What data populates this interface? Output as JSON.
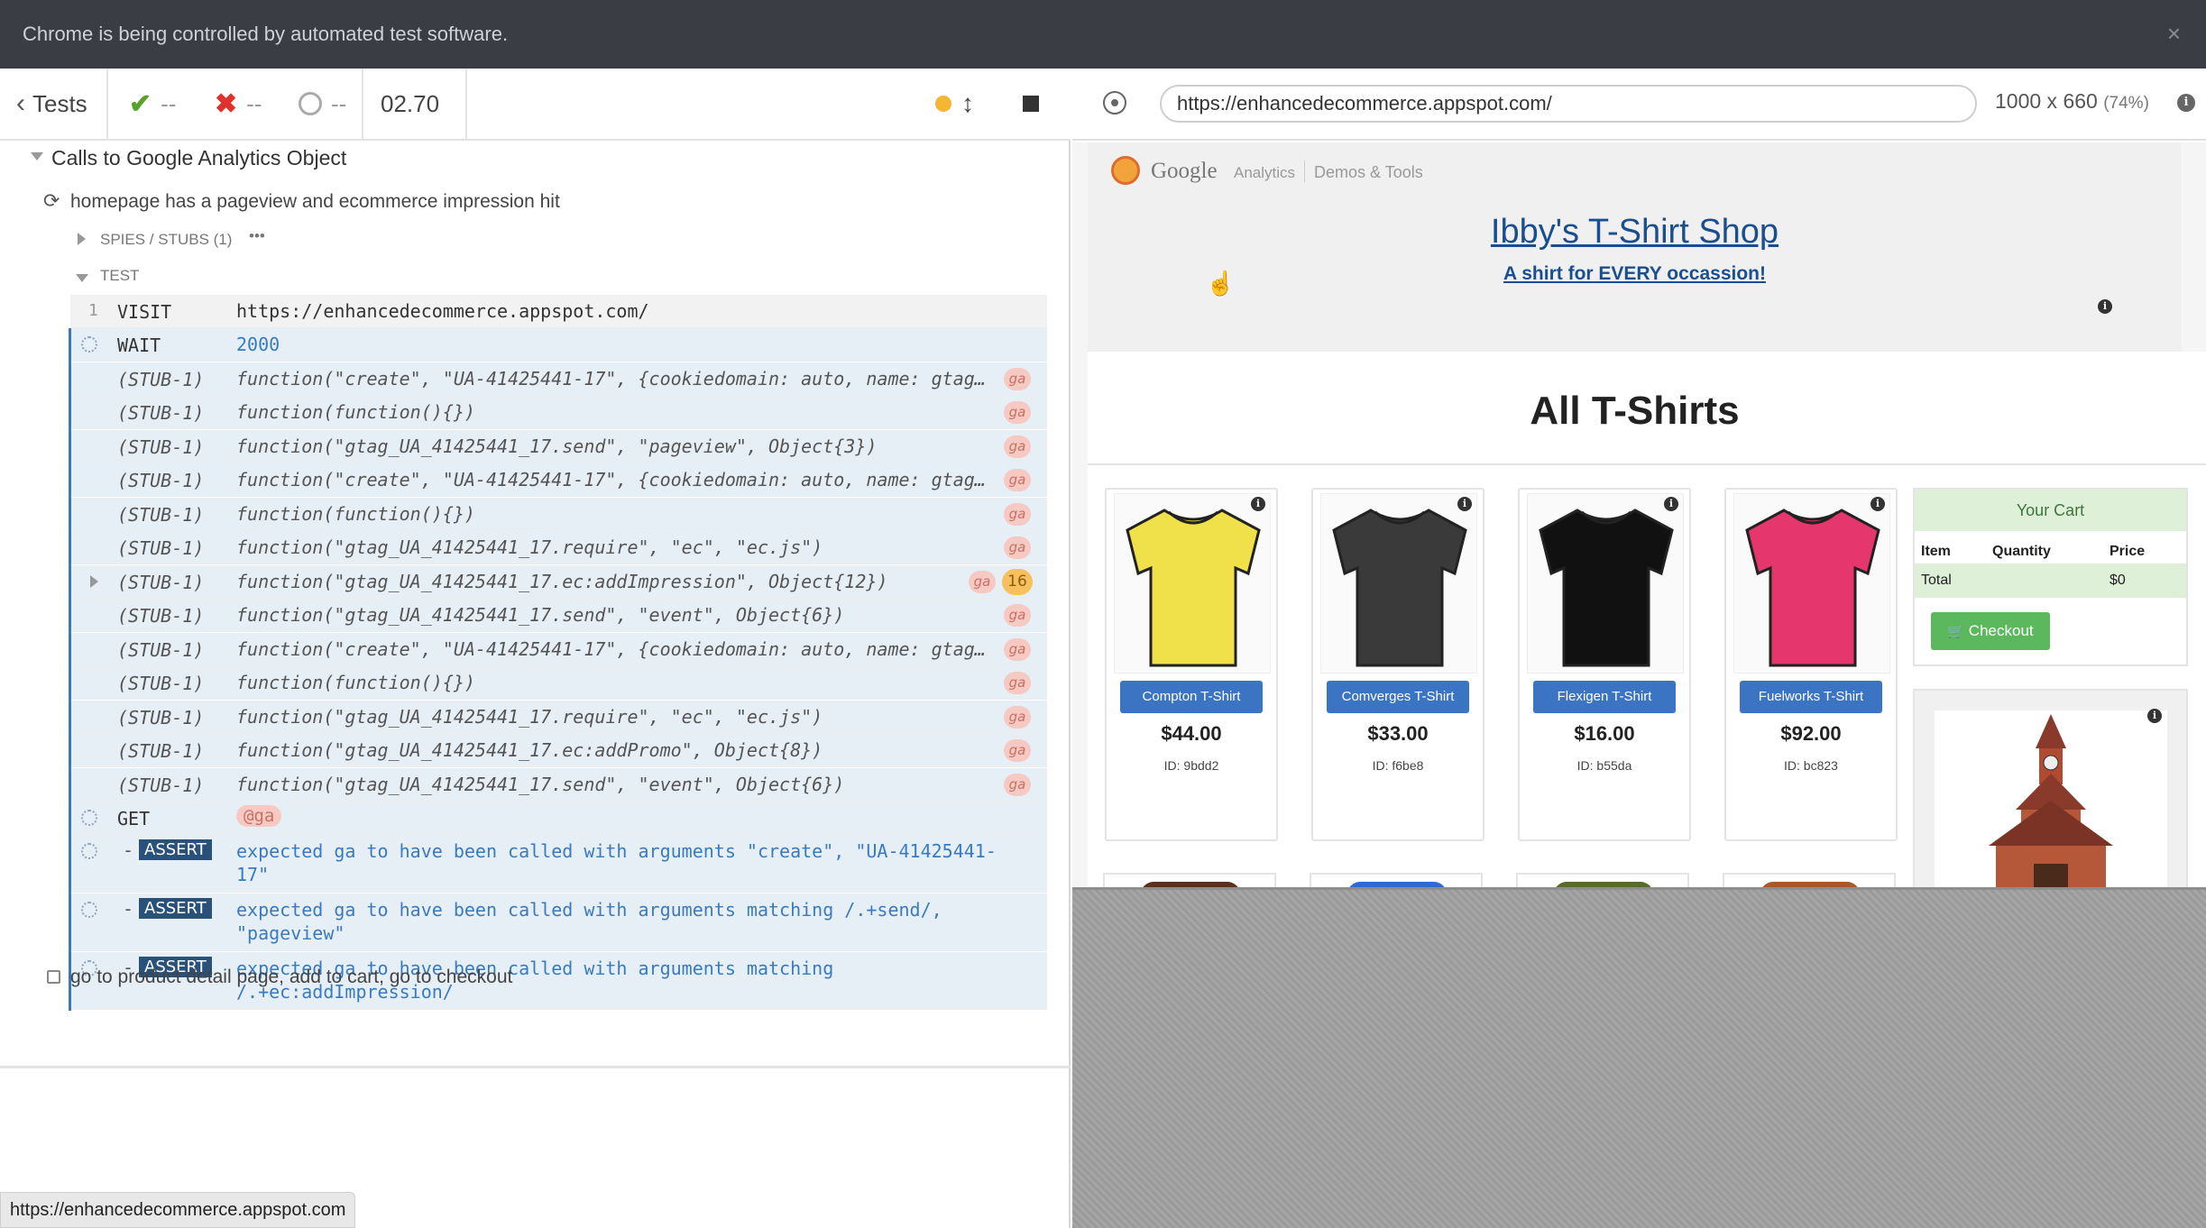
{
  "infobar": {
    "message": "Chrome is being controlled by automated test software.",
    "close": "×"
  },
  "reporter": {
    "tests_label": "Tests",
    "passed": "--",
    "failed": "--",
    "pending": "--",
    "duration": "02.70",
    "suite_title": "Calls to Google Analytics Object",
    "test_title": "homepage has a pageview and ecommerce impression hit",
    "spies_label": "SPIES / STUBS (1)",
    "spies_more": "•••",
    "test_label": "TEST",
    "commands": [
      {
        "num": "1",
        "name": "VISIT",
        "msg": "https://enhancedecommerce.appspot.com/"
      },
      {
        "num": "",
        "name": "WAIT",
        "msg": "2000"
      },
      {
        "name": "(STUB-1)",
        "msg": "function(\"create\", \"UA-41425441-17\", {cookiedomain: auto, name: gtag…",
        "badge": "ga"
      },
      {
        "name": "(STUB-1)",
        "msg": "function(function(){})",
        "badge": "ga"
      },
      {
        "name": "(STUB-1)",
        "msg": "function(\"gtag_UA_41425441_17.send\", \"pageview\", Object{3})",
        "badge": "ga"
      },
      {
        "name": "(STUB-1)",
        "msg": "function(\"create\", \"UA-41425441-17\", {cookiedomain: auto, name: gtag…",
        "badge": "ga"
      },
      {
        "name": "(STUB-1)",
        "msg": "function(function(){})",
        "badge": "ga"
      },
      {
        "name": "(STUB-1)",
        "msg": "function(\"gtag_UA_41425441_17.require\", \"ec\", \"ec.js\")",
        "badge": "ga"
      },
      {
        "name": "(STUB-1)",
        "msg": "function(\"gtag_UA_41425441_17.ec:addImpression\", Object{12})",
        "badge": "ga",
        "count": "16"
      },
      {
        "name": "(STUB-1)",
        "msg": "function(\"gtag_UA_41425441_17.send\", \"event\", Object{6})",
        "badge": "ga"
      },
      {
        "name": "(STUB-1)",
        "msg": "function(\"create\", \"UA-41425441-17\", {cookiedomain: auto, name: gtag…",
        "badge": "ga"
      },
      {
        "name": "(STUB-1)",
        "msg": "function(function(){})",
        "badge": "ga"
      },
      {
        "name": "(STUB-1)",
        "msg": "function(\"gtag_UA_41425441_17.require\", \"ec\", \"ec.js\")",
        "badge": "ga"
      },
      {
        "name": "(STUB-1)",
        "msg": "function(\"gtag_UA_41425441_17.ec:addPromo\", Object{8})",
        "badge": "ga"
      },
      {
        "name": "(STUB-1)",
        "msg": "function(\"gtag_UA_41425441_17.send\", \"event\", Object{6})",
        "badge": "ga"
      }
    ],
    "get_cmd": {
      "name": "GET",
      "alias": "@ga"
    },
    "asserts": [
      {
        "dash": "-",
        "label": "ASSERT",
        "line1": "expected ga to have been called with arguments \"create\", \"UA-41425441-",
        "line2": "17\""
      },
      {
        "dash": "-",
        "label": "ASSERT",
        "line1": "expected ga to have been called with arguments matching /.+send/,",
        "line2": "\"pageview\""
      },
      {
        "dash": "-",
        "label": "ASSERT",
        "line1": "expected ga to have been called with arguments matching",
        "line2": "/.+ec:addImpression/"
      }
    ],
    "next_test": "go to product detail page, add to cart, go to checkout"
  },
  "aut_header": {
    "url": "https://enhancedecommerce.appspot.com/",
    "size": "1000 x 660",
    "scale": "(74%)"
  },
  "shop": {
    "ga_google": "Google",
    "ga_analytics": "Analytics",
    "ga_demos": "Demos & Tools",
    "title": "Ibby's T-Shirt Shop",
    "subtitle": "A shirt for EVERY occassion!",
    "section_title": "All T-Shirts",
    "products": [
      {
        "name": "Compton T-Shirt",
        "price": "$44.00",
        "id": "ID: 9bdd2",
        "color": "#f0e14a"
      },
      {
        "name": "Comverges T-Shirt",
        "price": "$33.00",
        "id": "ID: f6be8",
        "color": "#3a3a3a"
      },
      {
        "name": "Flexigen T-Shirt",
        "price": "$16.00",
        "id": "ID: b55da",
        "color": "#111111"
      },
      {
        "name": "Fuelworks T-Shirt",
        "price": "$92.00",
        "id": "ID: bc823",
        "color": "#e5366e"
      }
    ],
    "cart": {
      "title": "Your Cart",
      "col_item": "Item",
      "col_qty": "Quantity",
      "col_price": "Price",
      "total_label": "Total",
      "total_value": "$0",
      "checkout": "Checkout"
    }
  },
  "status_url": "https://enhancedecommerce.appspot.com"
}
